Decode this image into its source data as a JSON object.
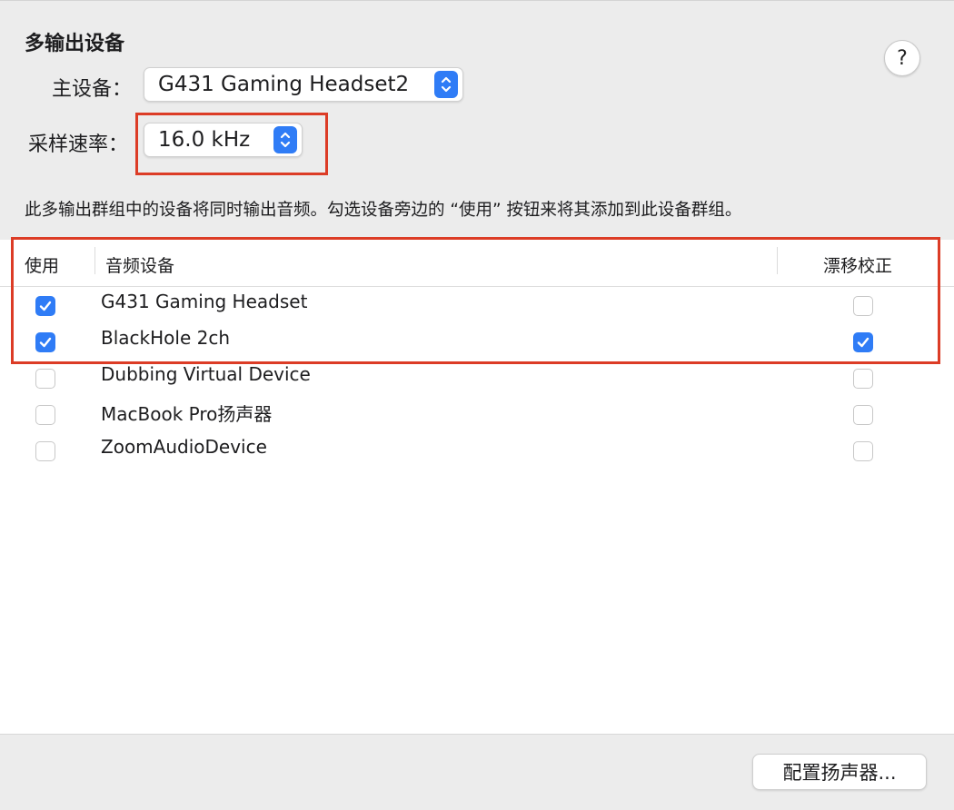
{
  "header": {
    "title": "多输出设备",
    "help_label": "?"
  },
  "master_device": {
    "label": "主设备：",
    "value": "G431 Gaming Headset2"
  },
  "sample_rate": {
    "label": "采样速率：",
    "value": "16.0 kHz"
  },
  "description": "此多输出群组中的设备将同时输出音频。勾选设备旁边的 “使用” 按钮来将其添加到此设备群组。",
  "table": {
    "columns": {
      "use": "使用",
      "device": "音频设备",
      "drift": "漂移校正"
    },
    "rows": [
      {
        "name": "G431 Gaming Headset",
        "use": true,
        "drift": false
      },
      {
        "name": "BlackHole 2ch",
        "use": true,
        "drift": true
      },
      {
        "name": "Dubbing Virtual Device",
        "use": false,
        "drift": false
      },
      {
        "name": "MacBook Pro扬声器",
        "use": false,
        "drift": false
      },
      {
        "name": "ZoomAudioDevice",
        "use": false,
        "drift": false
      }
    ]
  },
  "footer": {
    "configure_button": "配置扬声器..."
  },
  "colors": {
    "accent": "#2f7cf6",
    "highlight": "#dc3c26"
  }
}
